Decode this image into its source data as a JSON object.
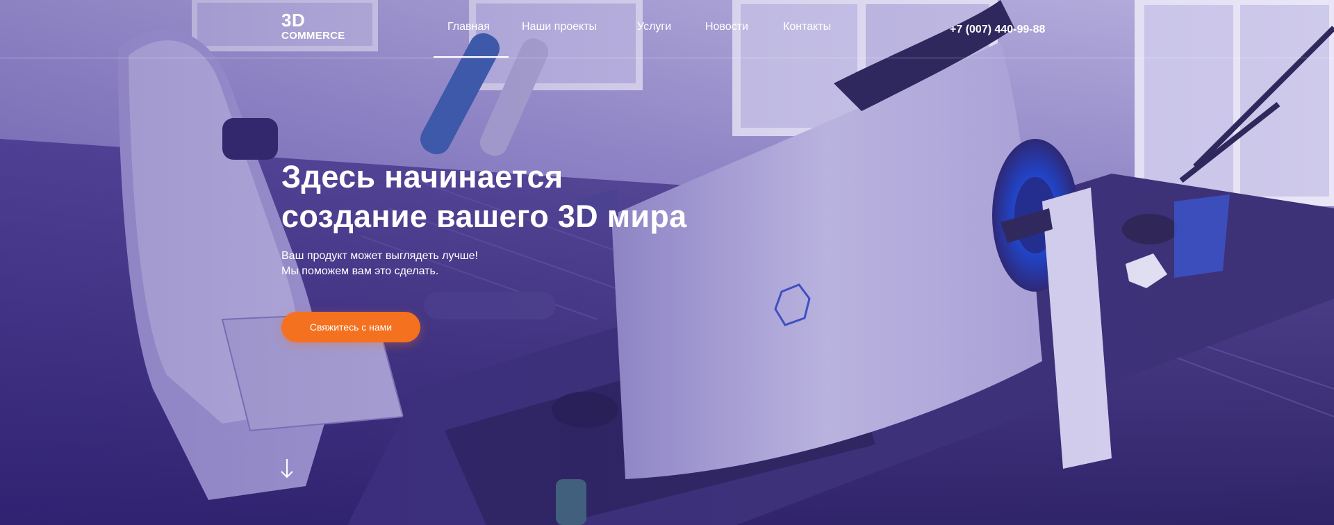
{
  "brand": {
    "logo_main": "3D",
    "logo_sub": "COMMERCE"
  },
  "nav": {
    "items": [
      {
        "label": "Главная",
        "active": true
      },
      {
        "label": "Наши проекты",
        "active": false
      },
      {
        "label": "Услуги",
        "active": false
      },
      {
        "label": "Новости",
        "active": false
      },
      {
        "label": "Контакты",
        "active": false
      }
    ]
  },
  "contact": {
    "phone": "+7 (007) 440-99-88"
  },
  "hero": {
    "title_line1": "Здесь начинается",
    "title_line2": "создание вашего 3D мира",
    "subtitle_line1": "Ваш продукт может выглядеть лучше!",
    "subtitle_line2": "Мы поможем вам это сделать.",
    "cta_label": "Свяжитесь с нами"
  },
  "icons": {
    "scroll": "arrow-down-icon"
  },
  "colors": {
    "overlay_purple": "#5b4aa6",
    "accent_orange": "#f4711f",
    "text": "#ffffff"
  }
}
